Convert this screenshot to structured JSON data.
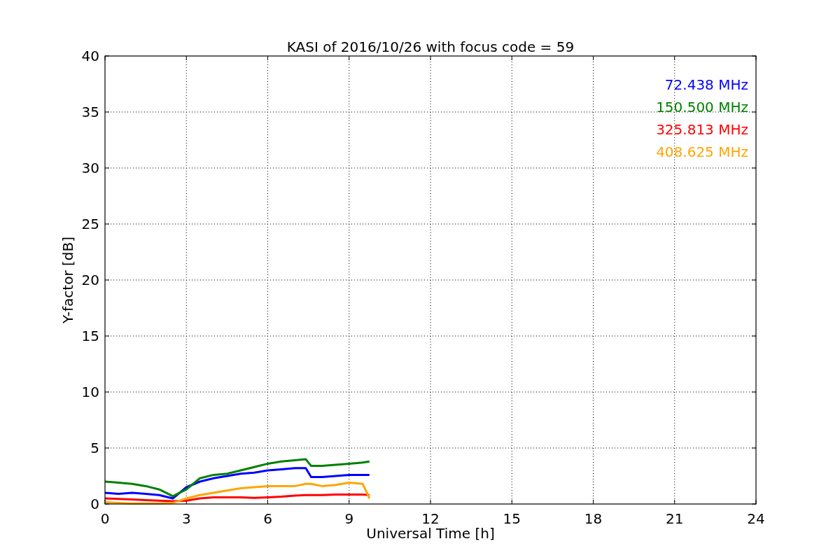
{
  "figure": {
    "chart_data": {
      "type": "line",
      "title": "KASI of 2016/10/26 with focus code = 59",
      "xlabel": "Universal Time [h]",
      "ylabel": "Y-factor [dB]",
      "x": [
        0,
        0.5,
        1,
        1.5,
        2,
        2.5,
        3,
        3.5,
        4,
        4.5,
        5,
        5.5,
        6,
        6.5,
        7,
        7.4,
        7.6,
        8,
        8.5,
        9,
        9.5,
        9.75
      ],
      "series": [
        {
          "name": "72.438 MHz",
          "color": "#0000ff",
          "values": [
            1.0,
            0.9,
            1.0,
            0.9,
            0.8,
            0.5,
            1.5,
            2.0,
            2.3,
            2.5,
            2.7,
            2.8,
            3.0,
            3.1,
            3.2,
            3.2,
            2.4,
            2.4,
            2.5,
            2.6,
            2.6,
            2.6
          ]
        },
        {
          "name": "150.500 MHz",
          "color": "#008000",
          "values": [
            2.0,
            1.9,
            1.8,
            1.6,
            1.3,
            0.7,
            1.3,
            2.3,
            2.6,
            2.7,
            3.0,
            3.3,
            3.6,
            3.8,
            3.9,
            4.0,
            3.4,
            3.4,
            3.5,
            3.6,
            3.7,
            3.8
          ]
        },
        {
          "name": "325.813 MHz",
          "color": "#ff0000",
          "values": [
            0.5,
            0.45,
            0.4,
            0.35,
            0.3,
            0.25,
            0.3,
            0.5,
            0.6,
            0.6,
            0.6,
            0.55,
            0.6,
            0.65,
            0.75,
            0.8,
            0.8,
            0.8,
            0.85,
            0.85,
            0.85,
            0.8
          ]
        },
        {
          "name": "408.625 MHz",
          "color": "#ffa500",
          "values": [
            0.15,
            0.1,
            0.05,
            0.05,
            0.05,
            0.1,
            0.5,
            0.8,
            1.0,
            1.2,
            1.4,
            1.5,
            1.6,
            1.6,
            1.6,
            1.8,
            1.8,
            1.6,
            1.7,
            1.9,
            1.8,
            0.5
          ]
        }
      ],
      "grid": true,
      "xlim": [
        0,
        24
      ],
      "ylim": [
        0,
        40
      ],
      "xticks": [
        0,
        3,
        6,
        9,
        12,
        15,
        18,
        21,
        24
      ],
      "yticks": [
        0,
        5,
        10,
        15,
        20,
        25,
        30,
        35,
        40
      ]
    }
  }
}
